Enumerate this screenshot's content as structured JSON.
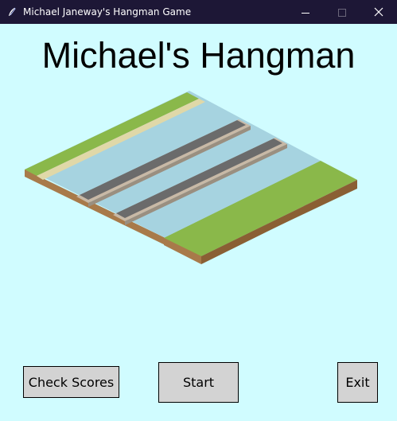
{
  "window": {
    "title": "Michael Janeway's Hangman Game",
    "app_icon": "feather-icon",
    "controls": [
      "minimize-icon",
      "maximize-icon",
      "close-icon"
    ],
    "titlebar_color": "#1d1736"
  },
  "main": {
    "heading": "Michael's Hangman",
    "background_color": "#d0fcff",
    "illustration": "isometric-road-tile"
  },
  "buttons": {
    "check_scores": "Check Scores",
    "start": "Start",
    "exit": "Exit"
  },
  "colors": {
    "button_bg": "#d3d3d3",
    "grass": "#8ab84a",
    "water": "#a6d3e0",
    "sand": "#e0d8a8",
    "dirt": "#a87a4a"
  }
}
